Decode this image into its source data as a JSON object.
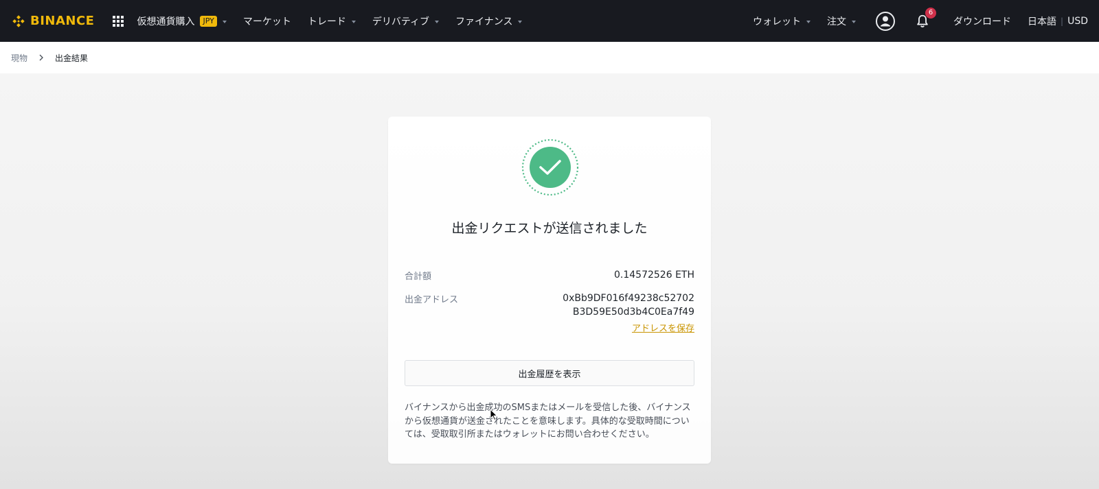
{
  "nav": {
    "logo_text": "BINANCE",
    "left_items": [
      {
        "label": "仮想通貨購入",
        "badge": "JPY",
        "has_caret": true
      },
      {
        "label": "マーケット",
        "has_caret": false
      },
      {
        "label": "トレード",
        "has_caret": true
      },
      {
        "label": "デリバティブ",
        "has_caret": true
      },
      {
        "label": "ファイナンス",
        "has_caret": true
      }
    ],
    "wallet_label": "ウォレット",
    "orders_label": "注文",
    "notification_count": "6",
    "download_label": "ダウンロード",
    "language_label": "日本語",
    "currency_label": "USD"
  },
  "breadcrumb": {
    "home": "現物",
    "current": "出金結果"
  },
  "result": {
    "title": "出金リクエストが送信されました",
    "total_label": "合計額",
    "total_value": "0.14572526 ETH",
    "address_label": "出金アドレス",
    "address_line1": "0xBb9DF016f49238c52702",
    "address_line2": "B3D59E50d3b4C0Ea7f49",
    "save_address": "アドレスを保存",
    "history_button": "出金履歴を表示",
    "notice": "バイナンスから出金成功のSMSまたはメールを受信した後、バイナンスから仮想通貨が送金されたことを意味します。具体的な受取時間については、受取取引所またはウォレットにお問い合わせください。"
  },
  "colors": {
    "brand": "#f0b90b",
    "nav_bg": "#181a20",
    "success": "#4dba87",
    "link": "#c99400",
    "badge_red": "#cf304a"
  },
  "icons": {
    "logo": "binance-diamond-icon",
    "apps": "grid-apps-icon",
    "user": "user-circle-icon",
    "bell": "bell-icon",
    "chevron": "chevron-right-icon",
    "success": "check-circle-icon",
    "cursor": "mouse-pointer-icon"
  }
}
